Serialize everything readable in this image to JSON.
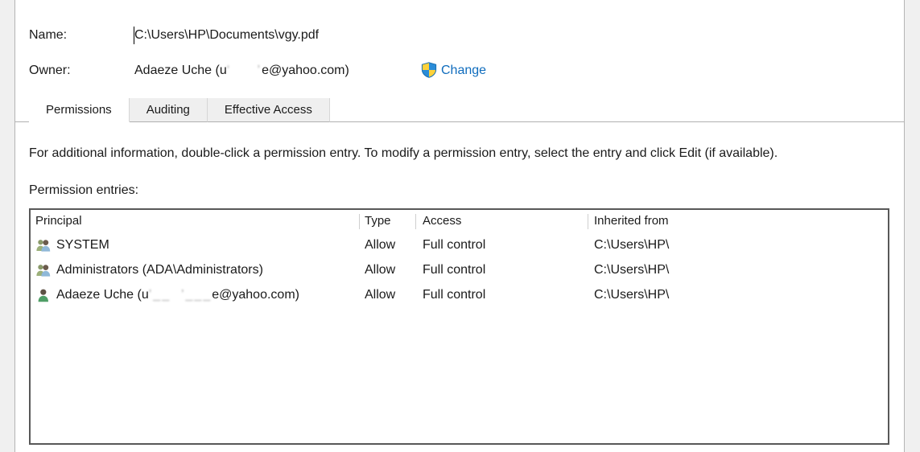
{
  "dialog": {
    "fields": [
      {
        "label": "Name:",
        "value": "C:\\Users\\HP\\Documents\\vgy.pdf"
      },
      {
        "label": "Owner:",
        "value_prefix": "Adaeze Uche (u",
        "value_redacted": "‘     ’",
        "value_suffix": "e@yahoo.com)"
      }
    ],
    "change_link": "Change",
    "shield_icon": "uac-shield-icon"
  },
  "tabs": [
    {
      "label": "Permissions",
      "active": true
    },
    {
      "label": "Auditing",
      "active": false
    },
    {
      "label": "Effective Access",
      "active": false
    }
  ],
  "body": {
    "info_text": "For additional information, double-click a permission entry. To modify a permission entry, select the entry and click Edit (if available).",
    "entries_label": "Permission entries:"
  },
  "table": {
    "columns": [
      "Principal",
      "Type",
      "Access",
      "Inherited from"
    ],
    "rows": [
      {
        "icon": "group-users-icon",
        "principal": "SYSTEM",
        "principal_redacted": "",
        "principal_suffix": "",
        "type": "Allow",
        "access": "Full control",
        "inherited_from": "C:\\Users\\HP\\"
      },
      {
        "icon": "group-users-icon",
        "principal": "Administrators (ADA\\Administrators)",
        "principal_redacted": "",
        "principal_suffix": "",
        "type": "Allow",
        "access": "Full control",
        "inherited_from": "C:\\Users\\HP\\"
      },
      {
        "icon": "single-user-icon",
        "principal": "Adaeze Uche (u",
        "principal_redacted": "’__  ’___",
        "principal_suffix": "e@yahoo.com)",
        "type": "Allow",
        "access": "Full control",
        "inherited_from": "C:\\Users\\HP\\"
      }
    ]
  },
  "colors": {
    "link": "#0f6cbd",
    "shield_blue": "#2a8cd8",
    "shield_yellow": "#ffd23a",
    "list_border": "#585858",
    "dialog_border": "#b4b4b4",
    "page_background": "#f0f0f0"
  }
}
